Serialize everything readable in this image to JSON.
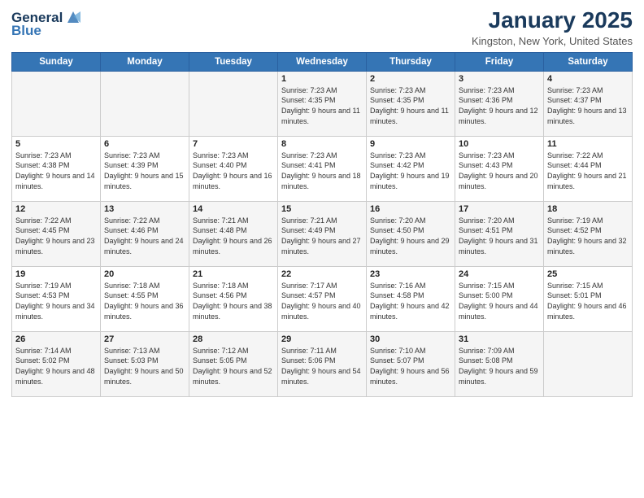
{
  "header": {
    "logo_line1": "General",
    "logo_line2": "Blue",
    "month": "January 2025",
    "location": "Kingston, New York, United States"
  },
  "days_of_week": [
    "Sunday",
    "Monday",
    "Tuesday",
    "Wednesday",
    "Thursday",
    "Friday",
    "Saturday"
  ],
  "weeks": [
    [
      {
        "day": "",
        "sunrise": "",
        "sunset": "",
        "daylight": ""
      },
      {
        "day": "",
        "sunrise": "",
        "sunset": "",
        "daylight": ""
      },
      {
        "day": "",
        "sunrise": "",
        "sunset": "",
        "daylight": ""
      },
      {
        "day": "1",
        "sunrise": "Sunrise: 7:23 AM",
        "sunset": "Sunset: 4:35 PM",
        "daylight": "Daylight: 9 hours and 11 minutes."
      },
      {
        "day": "2",
        "sunrise": "Sunrise: 7:23 AM",
        "sunset": "Sunset: 4:35 PM",
        "daylight": "Daylight: 9 hours and 11 minutes."
      },
      {
        "day": "3",
        "sunrise": "Sunrise: 7:23 AM",
        "sunset": "Sunset: 4:36 PM",
        "daylight": "Daylight: 9 hours and 12 minutes."
      },
      {
        "day": "4",
        "sunrise": "Sunrise: 7:23 AM",
        "sunset": "Sunset: 4:37 PM",
        "daylight": "Daylight: 9 hours and 13 minutes."
      }
    ],
    [
      {
        "day": "5",
        "sunrise": "Sunrise: 7:23 AM",
        "sunset": "Sunset: 4:38 PM",
        "daylight": "Daylight: 9 hours and 14 minutes."
      },
      {
        "day": "6",
        "sunrise": "Sunrise: 7:23 AM",
        "sunset": "Sunset: 4:39 PM",
        "daylight": "Daylight: 9 hours and 15 minutes."
      },
      {
        "day": "7",
        "sunrise": "Sunrise: 7:23 AM",
        "sunset": "Sunset: 4:40 PM",
        "daylight": "Daylight: 9 hours and 16 minutes."
      },
      {
        "day": "8",
        "sunrise": "Sunrise: 7:23 AM",
        "sunset": "Sunset: 4:41 PM",
        "daylight": "Daylight: 9 hours and 18 minutes."
      },
      {
        "day": "9",
        "sunrise": "Sunrise: 7:23 AM",
        "sunset": "Sunset: 4:42 PM",
        "daylight": "Daylight: 9 hours and 19 minutes."
      },
      {
        "day": "10",
        "sunrise": "Sunrise: 7:23 AM",
        "sunset": "Sunset: 4:43 PM",
        "daylight": "Daylight: 9 hours and 20 minutes."
      },
      {
        "day": "11",
        "sunrise": "Sunrise: 7:22 AM",
        "sunset": "Sunset: 4:44 PM",
        "daylight": "Daylight: 9 hours and 21 minutes."
      }
    ],
    [
      {
        "day": "12",
        "sunrise": "Sunrise: 7:22 AM",
        "sunset": "Sunset: 4:45 PM",
        "daylight": "Daylight: 9 hours and 23 minutes."
      },
      {
        "day": "13",
        "sunrise": "Sunrise: 7:22 AM",
        "sunset": "Sunset: 4:46 PM",
        "daylight": "Daylight: 9 hours and 24 minutes."
      },
      {
        "day": "14",
        "sunrise": "Sunrise: 7:21 AM",
        "sunset": "Sunset: 4:48 PM",
        "daylight": "Daylight: 9 hours and 26 minutes."
      },
      {
        "day": "15",
        "sunrise": "Sunrise: 7:21 AM",
        "sunset": "Sunset: 4:49 PM",
        "daylight": "Daylight: 9 hours and 27 minutes."
      },
      {
        "day": "16",
        "sunrise": "Sunrise: 7:20 AM",
        "sunset": "Sunset: 4:50 PM",
        "daylight": "Daylight: 9 hours and 29 minutes."
      },
      {
        "day": "17",
        "sunrise": "Sunrise: 7:20 AM",
        "sunset": "Sunset: 4:51 PM",
        "daylight": "Daylight: 9 hours and 31 minutes."
      },
      {
        "day": "18",
        "sunrise": "Sunrise: 7:19 AM",
        "sunset": "Sunset: 4:52 PM",
        "daylight": "Daylight: 9 hours and 32 minutes."
      }
    ],
    [
      {
        "day": "19",
        "sunrise": "Sunrise: 7:19 AM",
        "sunset": "Sunset: 4:53 PM",
        "daylight": "Daylight: 9 hours and 34 minutes."
      },
      {
        "day": "20",
        "sunrise": "Sunrise: 7:18 AM",
        "sunset": "Sunset: 4:55 PM",
        "daylight": "Daylight: 9 hours and 36 minutes."
      },
      {
        "day": "21",
        "sunrise": "Sunrise: 7:18 AM",
        "sunset": "Sunset: 4:56 PM",
        "daylight": "Daylight: 9 hours and 38 minutes."
      },
      {
        "day": "22",
        "sunrise": "Sunrise: 7:17 AM",
        "sunset": "Sunset: 4:57 PM",
        "daylight": "Daylight: 9 hours and 40 minutes."
      },
      {
        "day": "23",
        "sunrise": "Sunrise: 7:16 AM",
        "sunset": "Sunset: 4:58 PM",
        "daylight": "Daylight: 9 hours and 42 minutes."
      },
      {
        "day": "24",
        "sunrise": "Sunrise: 7:15 AM",
        "sunset": "Sunset: 5:00 PM",
        "daylight": "Daylight: 9 hours and 44 minutes."
      },
      {
        "day": "25",
        "sunrise": "Sunrise: 7:15 AM",
        "sunset": "Sunset: 5:01 PM",
        "daylight": "Daylight: 9 hours and 46 minutes."
      }
    ],
    [
      {
        "day": "26",
        "sunrise": "Sunrise: 7:14 AM",
        "sunset": "Sunset: 5:02 PM",
        "daylight": "Daylight: 9 hours and 48 minutes."
      },
      {
        "day": "27",
        "sunrise": "Sunrise: 7:13 AM",
        "sunset": "Sunset: 5:03 PM",
        "daylight": "Daylight: 9 hours and 50 minutes."
      },
      {
        "day": "28",
        "sunrise": "Sunrise: 7:12 AM",
        "sunset": "Sunset: 5:05 PM",
        "daylight": "Daylight: 9 hours and 52 minutes."
      },
      {
        "day": "29",
        "sunrise": "Sunrise: 7:11 AM",
        "sunset": "Sunset: 5:06 PM",
        "daylight": "Daylight: 9 hours and 54 minutes."
      },
      {
        "day": "30",
        "sunrise": "Sunrise: 7:10 AM",
        "sunset": "Sunset: 5:07 PM",
        "daylight": "Daylight: 9 hours and 56 minutes."
      },
      {
        "day": "31",
        "sunrise": "Sunrise: 7:09 AM",
        "sunset": "Sunset: 5:08 PM",
        "daylight": "Daylight: 9 hours and 59 minutes."
      },
      {
        "day": "",
        "sunrise": "",
        "sunset": "",
        "daylight": ""
      }
    ]
  ]
}
